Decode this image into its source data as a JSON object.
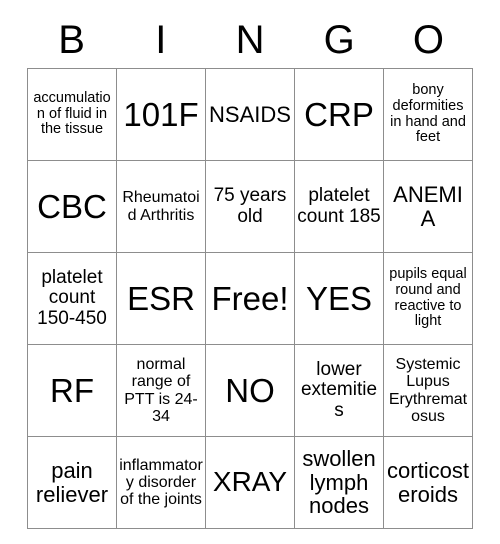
{
  "card": {
    "title": "BINGO",
    "header_letters": [
      "B",
      "I",
      "N",
      "G",
      "O"
    ],
    "free_space_label": "Free!",
    "columns": 5,
    "rows": 5,
    "border_color": "#8d8d8d",
    "text_color": "#000000",
    "background_color": "#ffffff",
    "cells": [
      [
        {
          "text": "accumulation of fluid in the tissue",
          "size": "xs"
        },
        {
          "text": "101F",
          "size": "xxl"
        },
        {
          "text": "NSAIDS",
          "size": "l"
        },
        {
          "text": "CRP",
          "size": "xxl"
        },
        {
          "text": "bony deformities in hand and feet",
          "size": "xs"
        }
      ],
      [
        {
          "text": "CBC",
          "size": "xxl"
        },
        {
          "text": "Rheumatoid Arthritis",
          "size": "s"
        },
        {
          "text": "75 years old",
          "size": "m"
        },
        {
          "text": "platelet count 185",
          "size": "m"
        },
        {
          "text": "ANEMIA",
          "size": "l"
        }
      ],
      [
        {
          "text": "platelet count 150-450",
          "size": "m"
        },
        {
          "text": "ESR",
          "size": "xxl"
        },
        {
          "text": "Free!",
          "size": "xxl"
        },
        {
          "text": "YES",
          "size": "xxl"
        },
        {
          "text": "pupils equal round and reactive to light",
          "size": "xs"
        }
      ],
      [
        {
          "text": "RF",
          "size": "xxl"
        },
        {
          "text": "normal range of PTT is 24-34",
          "size": "s"
        },
        {
          "text": "NO",
          "size": "xxl"
        },
        {
          "text": "lower extemities",
          "size": "m"
        },
        {
          "text": "Systemic Lupus Erythrematosus",
          "size": "s"
        }
      ],
      [
        {
          "text": "pain reliever",
          "size": "l"
        },
        {
          "text": "inflammatory disorder of the joints",
          "size": "s"
        },
        {
          "text": "XRAY",
          "size": "xl"
        },
        {
          "text": "swollen lymph nodes",
          "size": "l"
        },
        {
          "text": "corticosteroids",
          "size": "l"
        }
      ]
    ]
  }
}
